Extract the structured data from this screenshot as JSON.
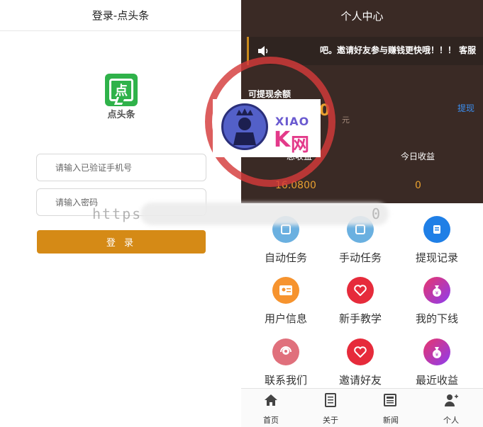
{
  "login": {
    "header_title": "登录-点头条",
    "logo_glyph": "点",
    "app_name": "点头条",
    "phone_placeholder": "请输入已验证手机号",
    "password_placeholder": "请输入密码",
    "login_button": "登 录"
  },
  "center": {
    "title": "个人中心",
    "notice": "吧。邀请好友参与赚钱更快哦！！！ 客服",
    "balance_label": "可提现余额",
    "balance_value": "0",
    "balance_unit": "元",
    "withdraw_link": "提现",
    "total_income_label": "总收益",
    "today_income_label": "今日收益",
    "total_income_value": "16.0800",
    "today_income_value": "0",
    "grid": [
      {
        "label": "自动任务",
        "icon": "auto-task-icon"
      },
      {
        "label": "手动任务",
        "icon": "manual-task-icon"
      },
      {
        "label": "提现记录",
        "icon": "withdraw-record-icon"
      },
      {
        "label": "用户信息",
        "icon": "user-info-icon"
      },
      {
        "label": "新手教学",
        "icon": "tutorial-icon"
      },
      {
        "label": "我的下线",
        "icon": "downline-icon"
      },
      {
        "label": "联系我们",
        "icon": "contact-icon"
      },
      {
        "label": "邀请好友",
        "icon": "invite-icon"
      },
      {
        "label": "最近收益",
        "icon": "recent-income-icon"
      }
    ],
    "tabs": [
      {
        "label": "首页",
        "icon": "home-icon"
      },
      {
        "label": "关于",
        "icon": "about-icon"
      },
      {
        "label": "新闻",
        "icon": "news-icon"
      },
      {
        "label": "个人",
        "icon": "profile-icon"
      }
    ]
  },
  "watermark": {
    "xiao": "XIAO",
    "k": "K",
    "net": "网",
    "url_prefix": "https",
    "url_tail": "0"
  },
  "colors": {
    "login_button": "#d58a16",
    "header_dark": "#3a2a25",
    "accent_orange": "#e8a030",
    "link_blue": "#3a8ef0",
    "app_green": "#2fb24a"
  }
}
